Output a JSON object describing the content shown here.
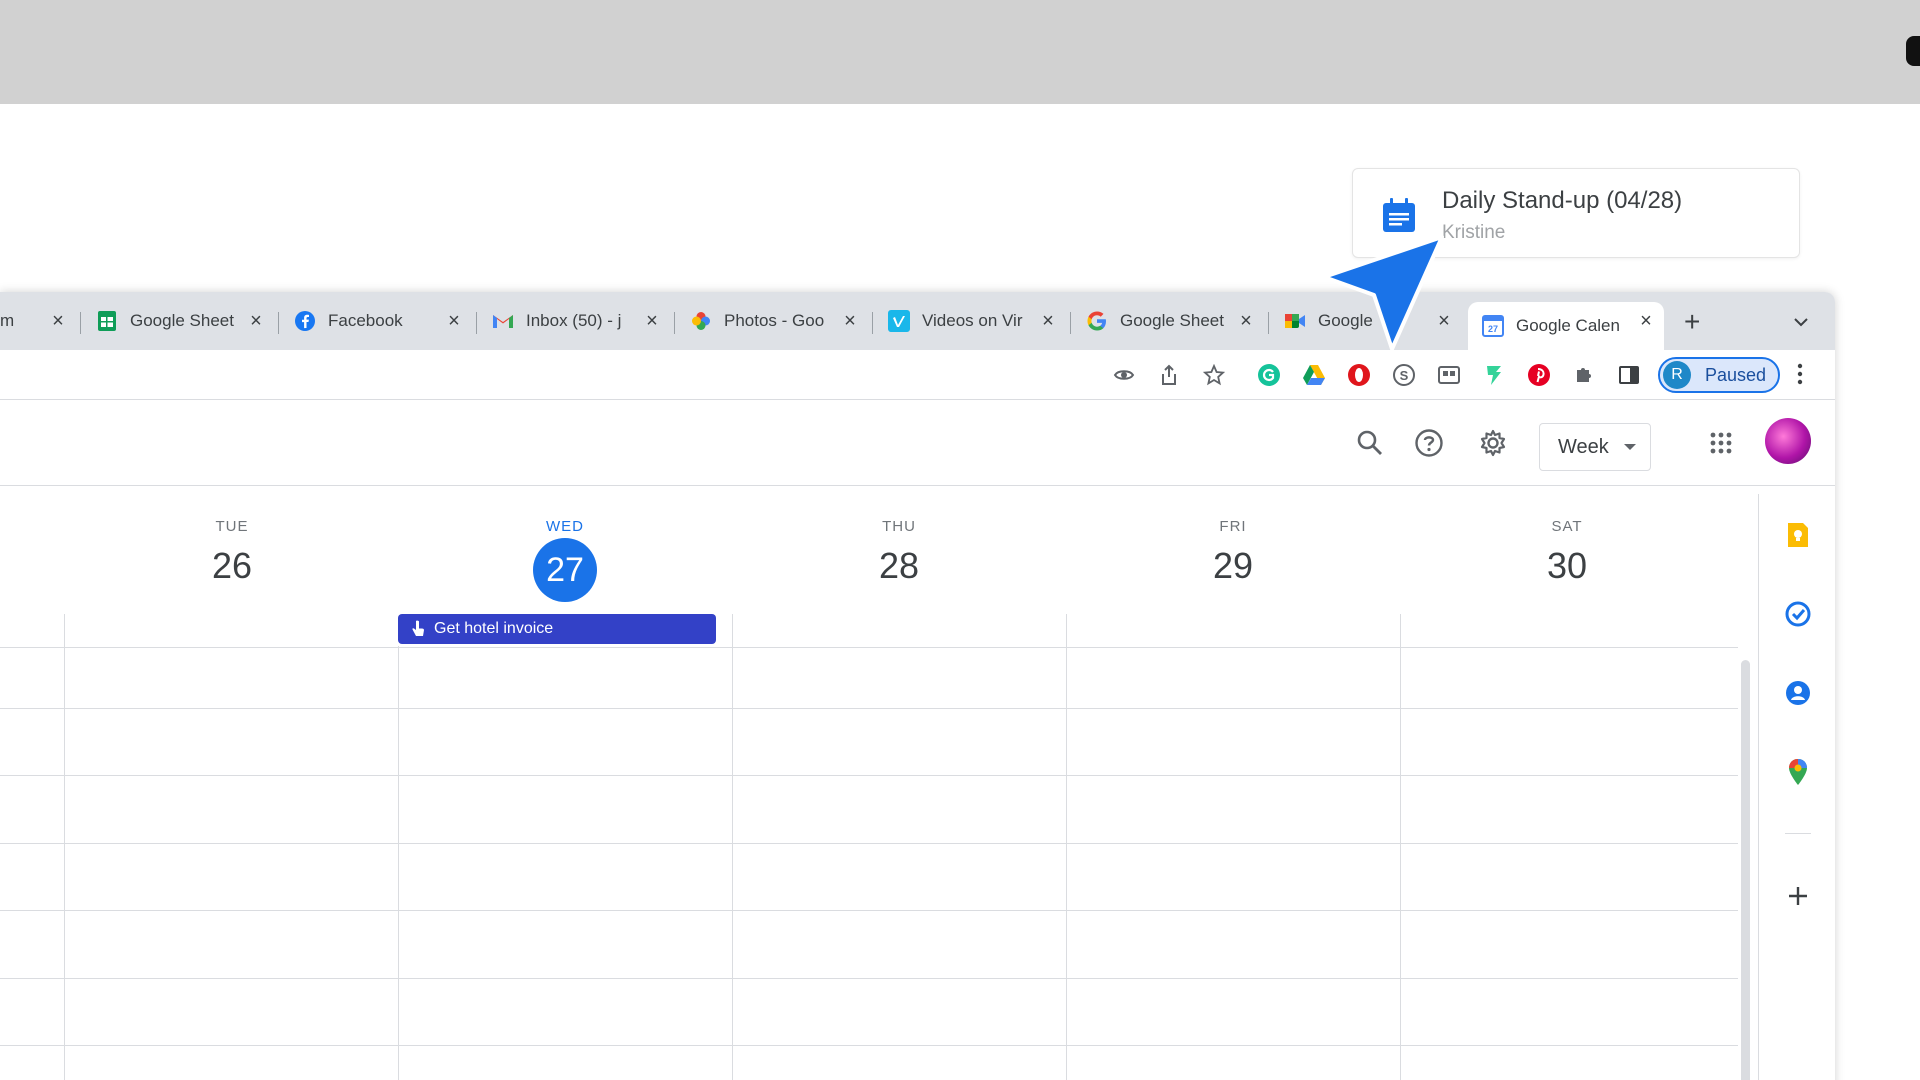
{
  "notification": {
    "title": "Daily Stand-up (04/28)",
    "subtitle": "Kristine"
  },
  "tabs": [
    {
      "title": "m",
      "favicon": "generic-icon",
      "active": false
    },
    {
      "title": "Google Sheet",
      "favicon": "sheets-icon",
      "active": false
    },
    {
      "title": "Facebook",
      "favicon": "facebook-icon",
      "active": false
    },
    {
      "title": "Inbox (50) - j",
      "favicon": "gmail-icon",
      "active": false
    },
    {
      "title": "Photos - Goo",
      "favicon": "photos-icon",
      "active": false
    },
    {
      "title": "Videos on Vir",
      "favicon": "vimeo-icon",
      "active": false
    },
    {
      "title": "Google Sheet",
      "favicon": "google-icon",
      "active": false
    },
    {
      "title": "Google",
      "favicon": "meet-icon",
      "active": false
    },
    {
      "title": "Google Calen",
      "favicon": "calendar-icon",
      "active": true
    }
  ],
  "toolbar": {
    "profile_initial": "R",
    "profile_status": "Paused"
  },
  "header": {
    "view_label": "Week"
  },
  "days": [
    {
      "name": "TUE",
      "number": "26",
      "today": false
    },
    {
      "name": "WED",
      "number": "27",
      "today": true
    },
    {
      "name": "THU",
      "number": "28",
      "today": false
    },
    {
      "name": "FRI",
      "number": "29",
      "today": false
    },
    {
      "name": "SAT",
      "number": "30",
      "today": false
    }
  ],
  "event": {
    "title": "Get hotel invoice"
  },
  "colors": {
    "accent": "#1a73e8",
    "event_bg": "#3341c7"
  }
}
